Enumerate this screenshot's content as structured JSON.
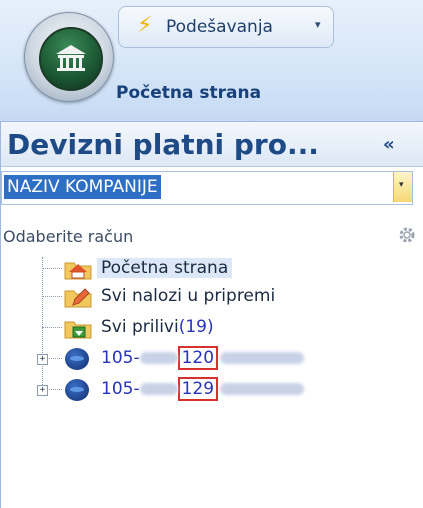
{
  "ribbon": {
    "settings_label": "Podešavanja",
    "settings_caret": "▾",
    "home_tab_label": "Početna strana"
  },
  "pane": {
    "title": "Devizni platni pro...",
    "collapse_glyph": "«",
    "company_value": "NAZIV KOMPANIJE",
    "company_button_glyph": "▾",
    "select_account_label": "Odaberite račun"
  },
  "tree": {
    "items": [
      {
        "label": "Početna strana",
        "icon": "home-folder-icon",
        "selected": true
      },
      {
        "label": "Svi nalozi u pripremi",
        "icon": "edit-folder-icon",
        "selected": false
      },
      {
        "label": "Svi prilivi",
        "count": "(19)",
        "icon": "incoming-folder-icon",
        "selected": false
      }
    ],
    "accounts": [
      {
        "prefix": "105-",
        "highlight": "120",
        "expander": "+"
      },
      {
        "prefix": "105-",
        "highlight": "129",
        "expander": "+"
      }
    ]
  },
  "colors": {
    "ribbon_bg": "#d6e6f8",
    "title_blue": "#1e4a86",
    "selection_blue": "#2d6fc4",
    "link_blue": "#2733b8",
    "highlight_red": "#d6312f"
  }
}
